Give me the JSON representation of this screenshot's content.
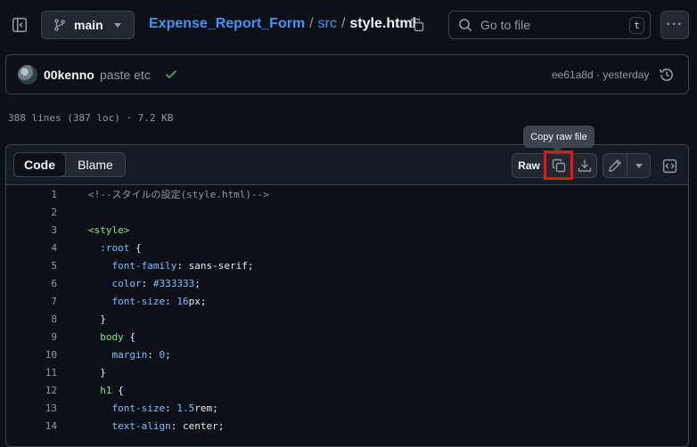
{
  "branch": {
    "name": "main"
  },
  "breadcrumb": {
    "repo": "Expense_Report_Form",
    "separator": "/",
    "folder": "src",
    "file": "style.html"
  },
  "search": {
    "placeholder": "Go to file",
    "shortcut": "t"
  },
  "commit": {
    "author": "00kenno",
    "message": "paste etc",
    "hash_time": "ee61a8d · yesterday"
  },
  "file_stats": "388 lines (387 loc) · 7.2 KB",
  "tabs": {
    "code": "Code",
    "blame": "Blame"
  },
  "toolbar": {
    "raw": "Raw"
  },
  "tooltip": "Copy raw file",
  "colors": {
    "background": "#0d1117",
    "accent_link": "#4493f8",
    "highlight_box": "#e5161b",
    "success": "#3fb950"
  },
  "icons": {
    "sidebar": "sidebar-collapse-icon",
    "branch": "git-branch-icon",
    "copy": "copy-icon",
    "search": "search-icon",
    "more": "kebab-horizontal-icon",
    "check": "check-icon",
    "history": "history-icon",
    "download": "download-icon",
    "edit": "pencil-icon",
    "symbols": "code-square-icon"
  },
  "code_lines": [
    {
      "n": "1",
      "parts": [
        {
          "t": "<!--スタイルの設定(style.html)-->",
          "c": "c-comment"
        }
      ]
    },
    {
      "n": "2",
      "parts": []
    },
    {
      "n": "3",
      "parts": [
        {
          "t": "<style>",
          "c": "c-tag"
        }
      ]
    },
    {
      "n": "4",
      "parts": [
        {
          "t": "  :root ",
          "c": "c-prop"
        },
        {
          "t": "{",
          "c": "c-text"
        }
      ]
    },
    {
      "n": "5",
      "parts": [
        {
          "t": "    font-family",
          "c": "c-prop"
        },
        {
          "t": ": sans-serif;",
          "c": "c-text"
        }
      ]
    },
    {
      "n": "6",
      "parts": [
        {
          "t": "    color",
          "c": "c-prop"
        },
        {
          "t": ": ",
          "c": "c-text"
        },
        {
          "t": "#333333",
          "c": "c-num"
        },
        {
          "t": ";",
          "c": "c-text"
        }
      ]
    },
    {
      "n": "7",
      "parts": [
        {
          "t": "    font-size",
          "c": "c-prop"
        },
        {
          "t": ": ",
          "c": "c-text"
        },
        {
          "t": "16",
          "c": "c-num"
        },
        {
          "t": "px;",
          "c": "c-text"
        }
      ]
    },
    {
      "n": "8",
      "parts": [
        {
          "t": "  }",
          "c": "c-text"
        }
      ]
    },
    {
      "n": "9",
      "parts": [
        {
          "t": "  body ",
          "c": "c-tag"
        },
        {
          "t": "{",
          "c": "c-text"
        }
      ]
    },
    {
      "n": "10",
      "parts": [
        {
          "t": "    margin",
          "c": "c-prop"
        },
        {
          "t": ": ",
          "c": "c-text"
        },
        {
          "t": "0",
          "c": "c-num"
        },
        {
          "t": ";",
          "c": "c-text"
        }
      ]
    },
    {
      "n": "11",
      "parts": [
        {
          "t": "  }",
          "c": "c-text"
        }
      ]
    },
    {
      "n": "12",
      "parts": [
        {
          "t": "  h1 ",
          "c": "c-tag"
        },
        {
          "t": "{",
          "c": "c-text"
        }
      ]
    },
    {
      "n": "13",
      "parts": [
        {
          "t": "    font-size",
          "c": "c-prop"
        },
        {
          "t": ": ",
          "c": "c-text"
        },
        {
          "t": "1.5",
          "c": "c-num"
        },
        {
          "t": "rem;",
          "c": "c-text"
        }
      ]
    },
    {
      "n": "14",
      "parts": [
        {
          "t": "    text-align",
          "c": "c-prop"
        },
        {
          "t": ": center;",
          "c": "c-text"
        }
      ]
    }
  ]
}
